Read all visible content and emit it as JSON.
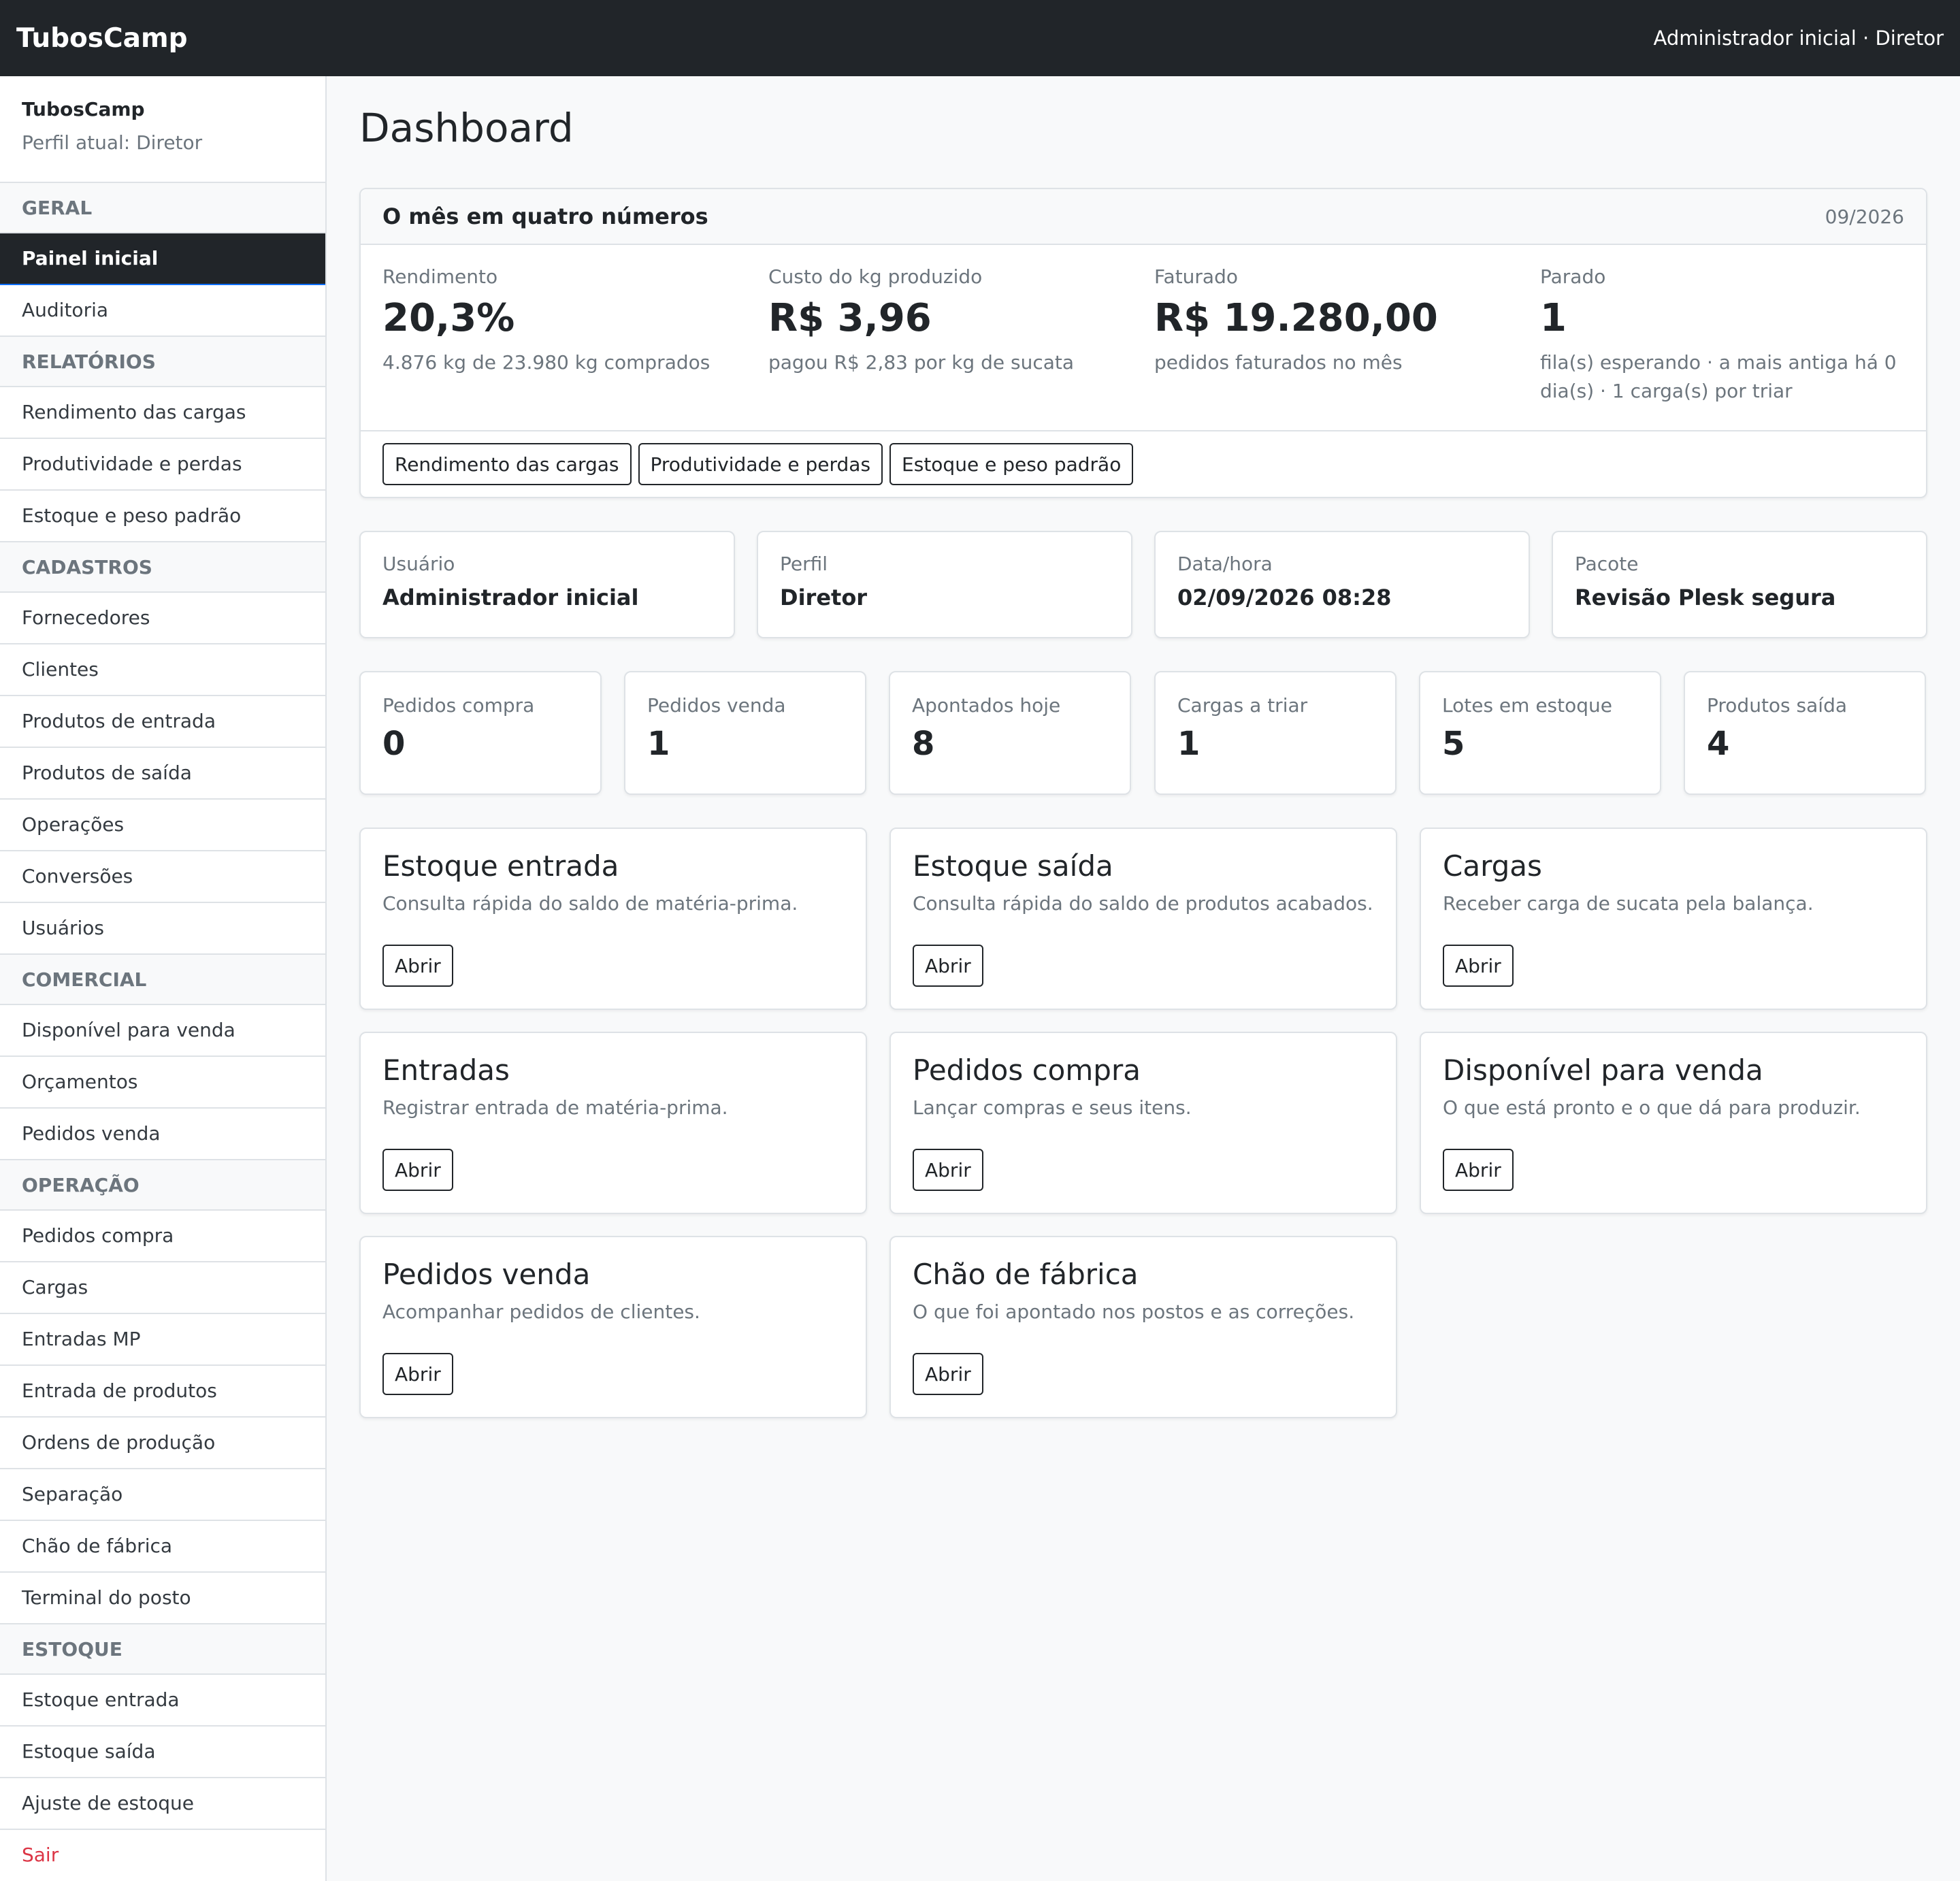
{
  "header": {
    "brand": "TubosCamp",
    "user_info": "Administrador inicial · Diretor"
  },
  "sidebar": {
    "app_name": "TubosCamp",
    "profile": "Perfil atual: Diretor",
    "sections": {
      "geral": "GERAL",
      "relatorios": "RELATÓRIOS",
      "cadastros": "CADASTROS",
      "comercial": "COMERCIAL",
      "operacao": "OPERAÇÃO",
      "estoque": "ESTOQUE"
    },
    "items": {
      "painel_inicial": "Painel inicial",
      "auditoria": "Auditoria",
      "rendimento_cargas": "Rendimento das cargas",
      "produtividade_perdas": "Produtividade e perdas",
      "estoque_peso_padrao": "Estoque e peso padrão",
      "fornecedores": "Fornecedores",
      "clientes": "Clientes",
      "produtos_entrada": "Produtos de entrada",
      "produtos_saida": "Produtos de saída",
      "operacoes": "Operações",
      "conversoes": "Conversões",
      "usuarios": "Usuários",
      "disponivel_venda": "Disponível para venda",
      "orcamentos": "Orçamentos",
      "pedidos_venda": "Pedidos venda",
      "pedidos_compra": "Pedidos compra",
      "cargas": "Cargas",
      "entradas_mp": "Entradas MP",
      "entrada_produtos": "Entrada de produtos",
      "ordens_producao": "Ordens de produção",
      "separacao": "Separação",
      "chao_fabrica": "Chão de fábrica",
      "terminal_posto": "Terminal do posto",
      "estoque_entrada": "Estoque entrada",
      "estoque_saida": "Estoque saída",
      "ajuste_estoque": "Ajuste de estoque",
      "sair": "Sair"
    }
  },
  "main": {
    "title": "Dashboard",
    "summary": {
      "title": "O mês em quatro números",
      "period": "09/2026",
      "kpis": [
        {
          "label": "Rendimento",
          "value": "20,3%",
          "sub": "4.876 kg de 23.980 kg comprados"
        },
        {
          "label": "Custo do kg produzido",
          "value": "R$ 3,96",
          "sub": "pagou R$ 2,83 por kg de sucata"
        },
        {
          "label": "Faturado",
          "value": "R$ 19.280,00",
          "sub": "pedidos faturados no mês"
        },
        {
          "label": "Parado",
          "value": "1",
          "sub": "fila(s) esperando · a mais antiga há 0 dia(s) · 1 carga(s) por triar"
        }
      ],
      "links": [
        "Rendimento das cargas",
        "Produtividade e perdas",
        "Estoque e peso padrão"
      ]
    },
    "info": [
      {
        "label": "Usuário",
        "value": "Administrador inicial"
      },
      {
        "label": "Perfil",
        "value": "Diretor"
      },
      {
        "label": "Data/hora",
        "value": "02/09/2026 08:28"
      },
      {
        "label": "Pacote",
        "value": "Revisão Plesk segura"
      }
    ],
    "stats": [
      {
        "label": "Pedidos compra",
        "value": "0"
      },
      {
        "label": "Pedidos venda",
        "value": "1"
      },
      {
        "label": "Apontados hoje",
        "value": "8"
      },
      {
        "label": "Cargas a triar",
        "value": "1"
      },
      {
        "label": "Lotes em estoque",
        "value": "5"
      },
      {
        "label": "Produtos saída",
        "value": "4"
      }
    ],
    "shortcuts": [
      {
        "title": "Estoque entrada",
        "desc": "Consulta rápida do saldo de matéria-prima.",
        "button": "Abrir"
      },
      {
        "title": "Estoque saída",
        "desc": "Consulta rápida do saldo de produtos acabados.",
        "button": "Abrir"
      },
      {
        "title": "Cargas",
        "desc": "Receber carga de sucata pela balança.",
        "button": "Abrir"
      },
      {
        "title": "Entradas",
        "desc": "Registrar entrada de matéria-prima.",
        "button": "Abrir"
      },
      {
        "title": "Pedidos compra",
        "desc": "Lançar compras e seus itens.",
        "button": "Abrir"
      },
      {
        "title": "Disponível para venda",
        "desc": "O que está pronto e o que dá para produzir.",
        "button": "Abrir"
      },
      {
        "title": "Pedidos venda",
        "desc": "Acompanhar pedidos de clientes.",
        "button": "Abrir"
      },
      {
        "title": "Chão de fábrica",
        "desc": "O que foi apontado nos postos e as correções.",
        "button": "Abrir"
      }
    ]
  }
}
